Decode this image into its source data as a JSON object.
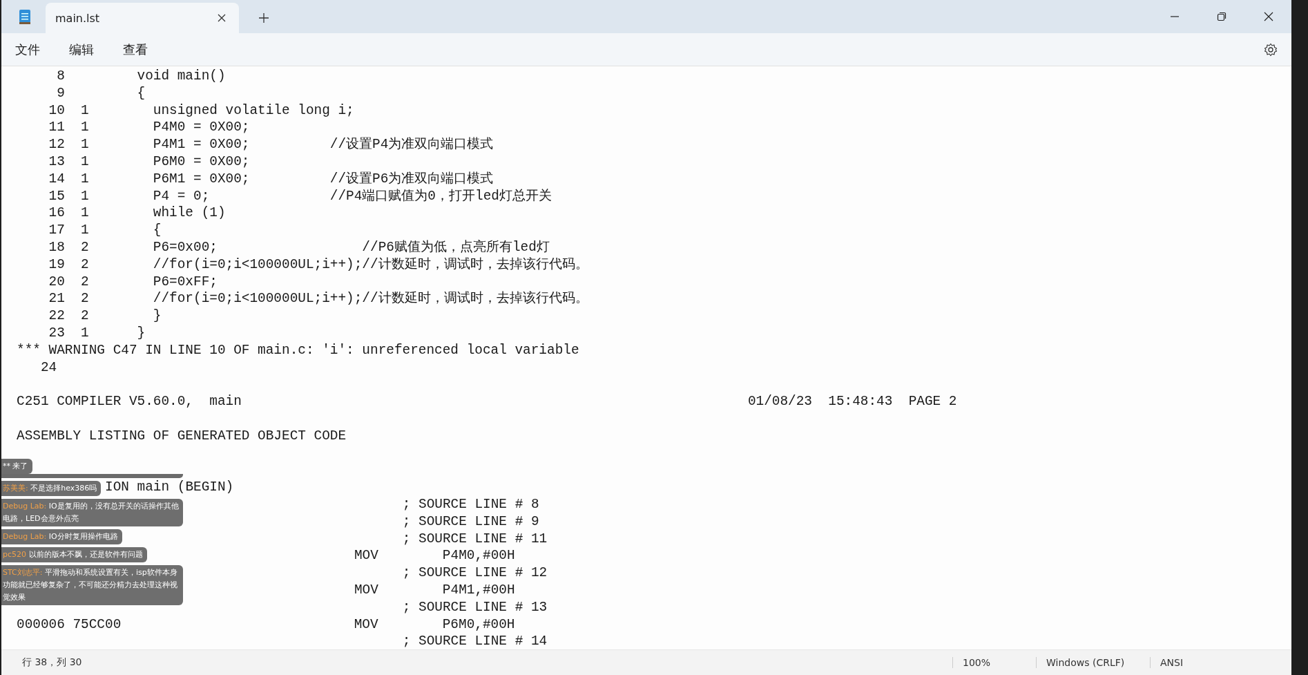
{
  "tab": {
    "title": "main.lst",
    "selected": true
  },
  "menu": [
    "文件",
    "编辑",
    "查看"
  ],
  "lines": [
    "     8         void main()",
    "     9         {",
    "    10  1        unsigned volatile long i;",
    "    11  1        P4M0 = 0X00;",
    "    12  1        P4M1 = 0X00;          //设置P4为准双向端口模式",
    "    13  1        P6M0 = 0X00;",
    "    14  1        P6M1 = 0X00;          //设置P6为准双向端口模式",
    "    15  1        P4 = 0;               //P4端口赋值为0，打开led灯总开关",
    "    16  1        while (1)",
    "    17  1        {",
    "    18  2        P6=0x00;                  //P6赋值为低，点亮所有led灯",
    "    19  2        //for(i=0;i<100000UL;i++);//计数延时，调试时，去掉该行代码。",
    "    20  2        P6=0xFF;",
    "    21  2        //for(i=0;i<100000UL;i++);//计数延时，调试时，去掉该行代码。",
    "    22  2        }",
    "    23  1      }",
    "*** WARNING C47 IN LINE 10 OF main.c: 'i': unreferenced local variable",
    "   24",
    {
      "kind": "blank"
    },
    "C251 COMPILER V5.60.0,  main                                                               01/08/23  15:48:43  PAGE 2",
    {
      "kind": "blank"
    },
    "ASSEMBLY LISTING OF GENERATED OBJECT CODE",
    {
      "kind": "blank"
    },
    {
      "kind": "blank"
    },
    "           ION main (BEGIN)",
    "                                                ; SOURCE LINE # 8",
    "                                                ; SOURCE LINE # 9",
    "                                                ; SOURCE LINE # 11",
    "                                          MOV        P4M0,#00H",
    "                                                ; SOURCE LINE # 12",
    "                                          MOV        P4M1,#00H",
    "                                                ; SOURCE LINE # 13",
    "000006 75CC00                             MOV        P6M0,#00H",
    "                                                ; SOURCE LINE # 14"
  ],
  "chat": [
    {
      "text": "** 来了"
    },
    {
      "name": "苏美美:",
      "text": "不是选择hex386吗"
    },
    {
      "name": "Debug Lab:",
      "text": "IO是复用的，没有总开关的话操作其他电路，LED会意外点亮"
    },
    {
      "name": "Debug Lab:",
      "text": "IO分时复用操作电路"
    },
    {
      "name": "pc520",
      "text": "以前的版本不飘，还是软件有问题"
    },
    {
      "name": "STC刘志平:",
      "text": "平滑拖动和系统设置有关，isp软件本身功能就已经够复杂了，不可能还分精力去处理这种视觉效果"
    }
  ],
  "status": {
    "position": "行 38，列 30",
    "zoom": "100%",
    "line_ending": "Windows (CRLF)",
    "encoding": "ANSI"
  }
}
